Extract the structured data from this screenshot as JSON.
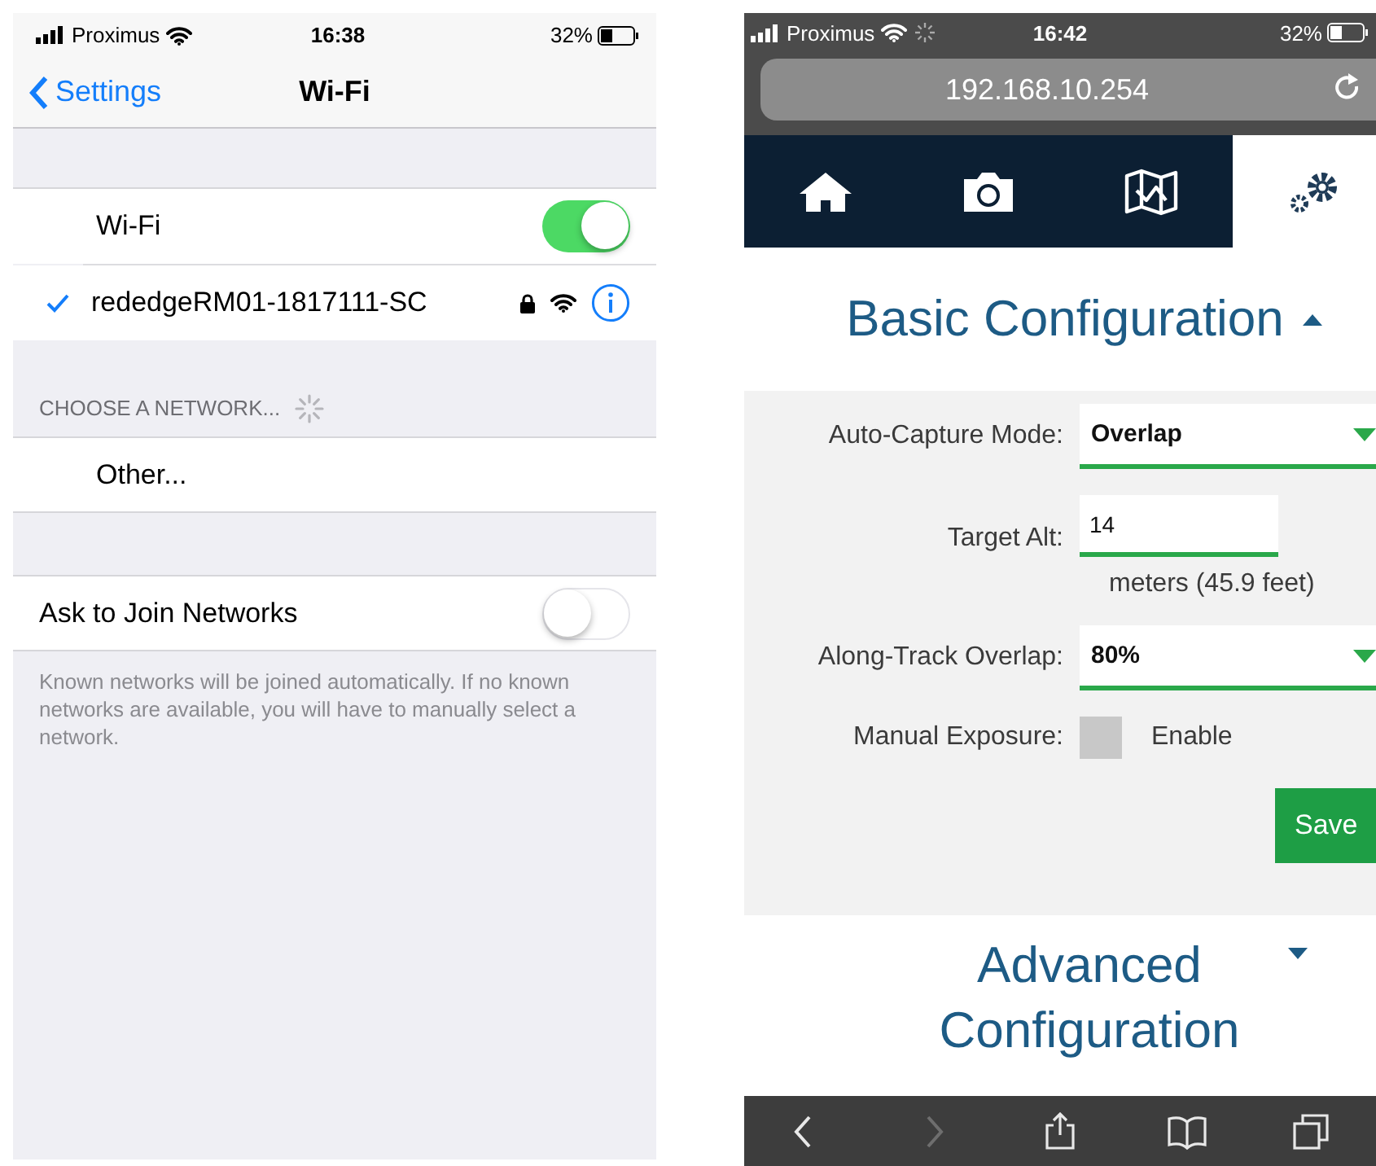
{
  "left_screen": {
    "status_bar": {
      "carrier": "Proximus",
      "time": "16:38",
      "battery": "32%"
    },
    "nav_bar": {
      "back": "Settings",
      "title": "Wi-Fi"
    },
    "wifi_row": {
      "label": "Wi-Fi",
      "on": true
    },
    "connected_network": {
      "name": "rededgeRM01-1817111-SC",
      "checked": true
    },
    "section_header": "CHOOSE A NETWORK...",
    "other_row": "Other...",
    "ask_to_join": {
      "label": "Ask to Join Networks",
      "on": false
    },
    "footer": "Known networks will be joined automatically. If no known networks are available, you will have to manually select a network."
  },
  "right_screen": {
    "status_bar": {
      "carrier": "Proximus",
      "time": "16:42",
      "battery": "32%"
    },
    "url": "192.168.10.254",
    "tabs": [
      {
        "kind": "home",
        "selected": false
      },
      {
        "kind": "camera",
        "selected": false
      },
      {
        "kind": "map",
        "selected": false
      },
      {
        "kind": "settings",
        "selected": true
      }
    ],
    "basic_section": {
      "title": "Basic Configuration",
      "expanded": true
    },
    "fields": [
      {
        "kind": "select",
        "label": "Auto-Capture Mode:",
        "value": "Overlap"
      },
      {
        "kind": "number",
        "label": "Target Alt:",
        "value": "14",
        "note": "meters (45.9 feet)"
      },
      {
        "kind": "select",
        "label": "Along-Track Overlap:",
        "value": "80%"
      },
      {
        "kind": "checkbox",
        "label": "Manual Exposure:",
        "option": "Enable",
        "checked": false
      }
    ],
    "save_button": "Save",
    "advanced_section": {
      "title": "Advanced Configuration",
      "expanded": false
    },
    "toolbar": [
      {
        "kind": "back",
        "disabled": false
      },
      {
        "kind": "forward",
        "disabled": true
      },
      {
        "kind": "share",
        "disabled": false
      },
      {
        "kind": "bookmarks",
        "disabled": false
      },
      {
        "kind": "tabs",
        "disabled": false
      }
    ]
  }
}
